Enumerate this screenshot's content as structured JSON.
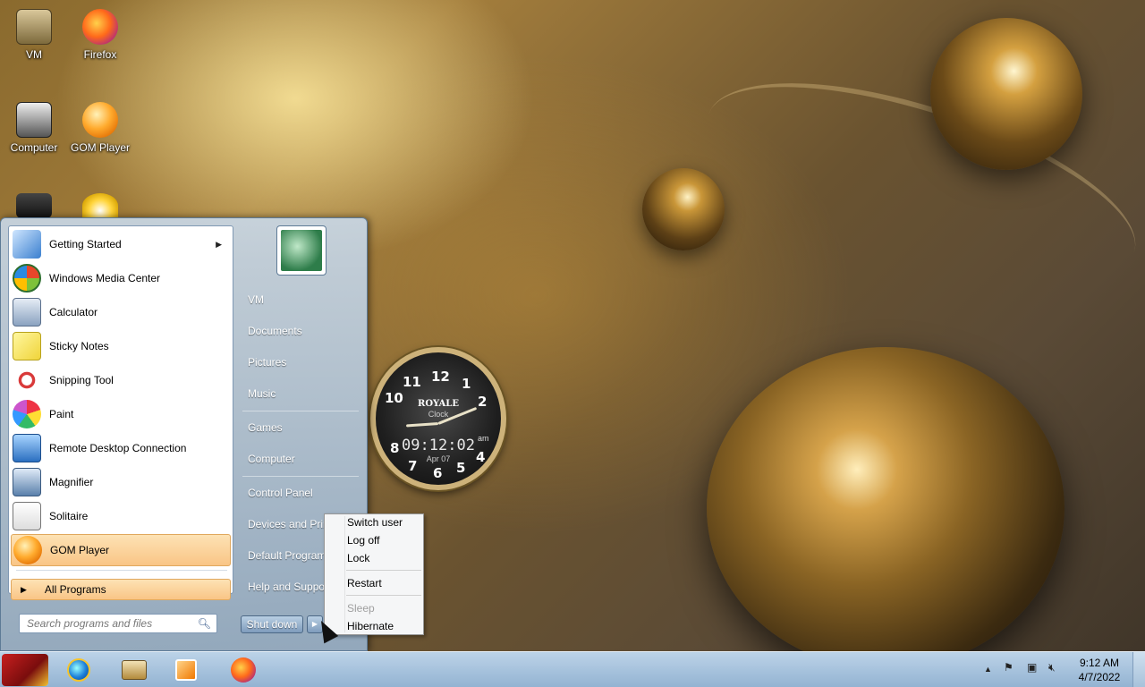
{
  "desktop": {
    "icons": [
      {
        "label": "VM",
        "icon": "vm-folder-icon"
      },
      {
        "label": "Firefox",
        "icon": "firefox-icon"
      },
      {
        "label": "Computer",
        "icon": "computer-icon"
      },
      {
        "label": "GOM Player",
        "icon": "gom-player-icon"
      }
    ]
  },
  "clock_gadget": {
    "brand": "ROYALE",
    "sub": "Clock",
    "digital_time": "09:12:02",
    "ampm": "am",
    "date": "Apr 07",
    "numerals": [
      "12",
      "1",
      "2",
      "4",
      "5",
      "6",
      "7",
      "8",
      "10",
      "11"
    ]
  },
  "start_menu": {
    "programs": [
      {
        "label": "Getting Started",
        "icon": "getting-started-icon",
        "has_submenu": true
      },
      {
        "label": "Windows Media Center",
        "icon": "windows-media-center-icon"
      },
      {
        "label": "Calculator",
        "icon": "calculator-icon"
      },
      {
        "label": "Sticky Notes",
        "icon": "sticky-notes-icon"
      },
      {
        "label": "Snipping Tool",
        "icon": "snipping-tool-icon"
      },
      {
        "label": "Paint",
        "icon": "paint-icon"
      },
      {
        "label": "Remote Desktop Connection",
        "icon": "remote-desktop-icon"
      },
      {
        "label": "Magnifier",
        "icon": "magnifier-icon"
      },
      {
        "label": "Solitaire",
        "icon": "solitaire-icon"
      },
      {
        "label": "GOM Player",
        "icon": "gom-player-icon",
        "selected": true
      }
    ],
    "all_programs": "All Programs",
    "search_placeholder": "Search programs and files",
    "right_items": [
      "VM",
      "Documents",
      "Pictures",
      "Music",
      "Games",
      "Computer",
      "Control Panel",
      "Devices and Prin",
      "Default Program",
      "Help and Suppo"
    ],
    "shutdown_label": "Shut down"
  },
  "shutdown_menu": {
    "items": [
      {
        "label": "Switch user",
        "enabled": true
      },
      {
        "label": "Log off",
        "enabled": true
      },
      {
        "label": "Lock",
        "enabled": true
      },
      {
        "label": "Restart",
        "enabled": true
      },
      {
        "label": "Sleep",
        "enabled": false
      },
      {
        "label": "Hibernate",
        "enabled": true
      }
    ]
  },
  "taskbar": {
    "pinned": [
      {
        "name": "Internet Explorer",
        "icon": "internet-explorer-icon"
      },
      {
        "name": "Libraries",
        "icon": "libraries-icon"
      },
      {
        "name": "Windows Media Player",
        "icon": "media-player-icon"
      },
      {
        "name": "Firefox",
        "icon": "firefox-icon"
      }
    ],
    "tray": {
      "time": "9:12 AM",
      "date": "4/7/2022"
    }
  },
  "colors": {
    "highlight": "#f9c586",
    "taskbar": "#bcd3e8",
    "start_menu": "#96afc8"
  }
}
